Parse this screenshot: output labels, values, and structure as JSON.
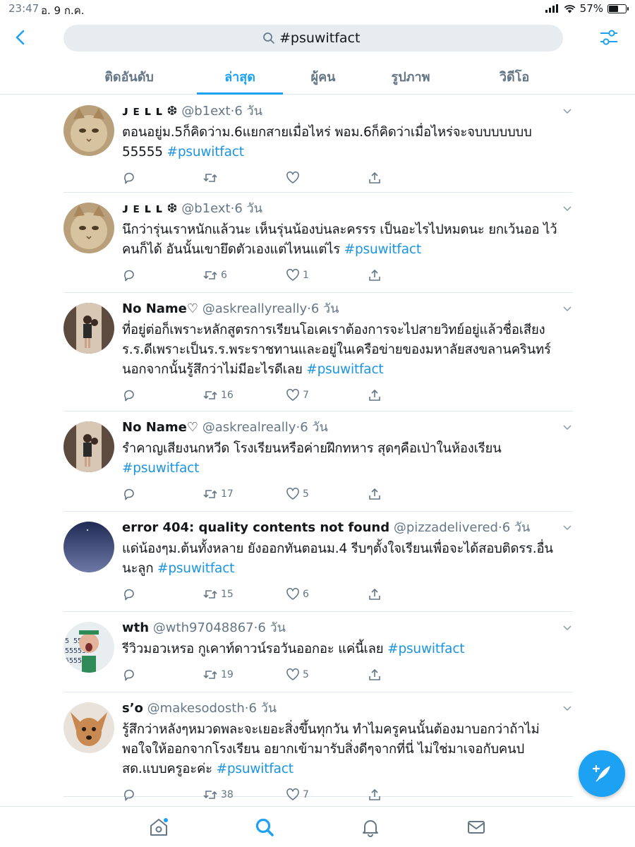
{
  "status_bar": {
    "time": "23:47",
    "date": "อ. 9 ก.ค.",
    "battery": "57%",
    "battery_level": 0.57
  },
  "search": {
    "query": "#psuwitfact"
  },
  "tabs": [
    {
      "label": "ติดอันดับ",
      "active": false
    },
    {
      "label": "ล่าสุด",
      "active": true
    },
    {
      "label": "ผู้คน",
      "active": false
    },
    {
      "label": "รูปภาพ",
      "active": false
    },
    {
      "label": "วิดีโอ",
      "active": false
    }
  ],
  "tweets": [
    {
      "name": "ᴊ ᴇ ʟ ʟ ❆",
      "handle": "@b1ext",
      "time": "6 วัน",
      "text": "ตอนอยู่ม.5ก็คิดว่าม.6แยกสายเมื่อไหร่ พอม.6ก็คิดว่าเมื่อไหร่จะจบบบบบบบ 55555 ",
      "hashtag": "#psuwitfact",
      "retweets": "",
      "likes": "",
      "avatar": "cat"
    },
    {
      "name": "ᴊ ᴇ ʟ ʟ ❆",
      "handle": "@b1ext",
      "time": "6 วัน",
      "text": "นึกว่ารุ่นเราหนักแล้วนะ เห็นรุ่นน้องบ่นละครรร เป็นอะไรไปหมดนะ ยกเว้นออ ไว้คนก็ได้ อันนั้นเขายึดตัวเองแต่ไหนแต่ไร ",
      "hashtag": "#psuwitfact",
      "retweets": "6",
      "likes": "1",
      "avatar": "cat"
    },
    {
      "name": "No Name♡",
      "handle": "@askreallyreally",
      "time": "6 วัน",
      "text": "ที่อยู่ต่อก็เพราะหลักสูตรการเรียนโอเคเราต้องการจะไปสายวิทย์อยู่แล้วชื่อเสียง ร.ร.ดีเพราะเป็นร.ร.พระราชทานและอยู่ในเครือข่ายของมหาลัยสงขลานครินทร์ นอกจากนั้นรู้สึกว่าไม่มีอะไรดีเลย ",
      "hashtag": "#psuwitfact",
      "retweets": "16",
      "likes": "7",
      "avatar": "mirror"
    },
    {
      "name": "No Name♡",
      "handle": "@askrealreally",
      "time": "6 วัน",
      "text": "รำคาญเสียงนกหวีด โรงเรียนหรือค่ายฝึกทหาร สุดๆคือเป่าในห้องเรียน ",
      "hashtag": "#psuwitfact",
      "retweets": "17",
      "likes": "5",
      "avatar": "mirror"
    },
    {
      "name": "error 404: quality contents not found",
      "handle": "@pizzadelivered",
      "time": "6 วัน",
      "text": "แด่น้องๆม.ต้นทั้งหลาย ยังออกทันตอนม.4 รีบๆตั้งใจเรียนเพื่อจะได้สอบติดรร.อื่นนะลูก ",
      "hashtag": "#psuwitfact",
      "retweets": "15",
      "likes": "6",
      "avatar": "night"
    },
    {
      "name": "wth",
      "handle": "@wth97048867",
      "time": "6 วัน",
      "text": "รีวิวมอวเหรอ กูเคาท์ดาวน์รอวันออกอะ  แค่นี้เลย ",
      "hashtag": "#psuwitfact",
      "retweets": "19",
      "likes": "5",
      "avatar": "kid"
    },
    {
      "name": "s’o",
      "handle": "@makesodosth",
      "time": "6 วัน",
      "text": "รู้สึกว่าหลังๆหมวดพละจะเยอะสิ่งขึ้นทุกวัน ทำไมครูคนนั้นต้องมาบอกว่าถ้าไม่พอใจให้ออกจากโรงเรียน อยากเข้ามารับสิ่งดีๆจากที่นี่ ไม่ใช่มาเจอกับคนปสด.แบบครูอะค่ะ ",
      "hashtag": "#psuwitfact",
      "retweets": "38",
      "likes": "7",
      "avatar": "dog"
    }
  ],
  "colors": {
    "accent": "#1da1f2",
    "secondary_text": "#657786",
    "hashtag": "#1b95e0"
  },
  "icons": {
    "back": "chevron-left-icon",
    "filter": "sliders-icon",
    "reply": "reply-icon",
    "retweet": "retweet-icon",
    "like": "heart-icon",
    "share": "share-icon",
    "compose": "compose-feather-icon",
    "nav": [
      "home-icon",
      "search-icon",
      "bell-icon",
      "mail-icon"
    ]
  }
}
